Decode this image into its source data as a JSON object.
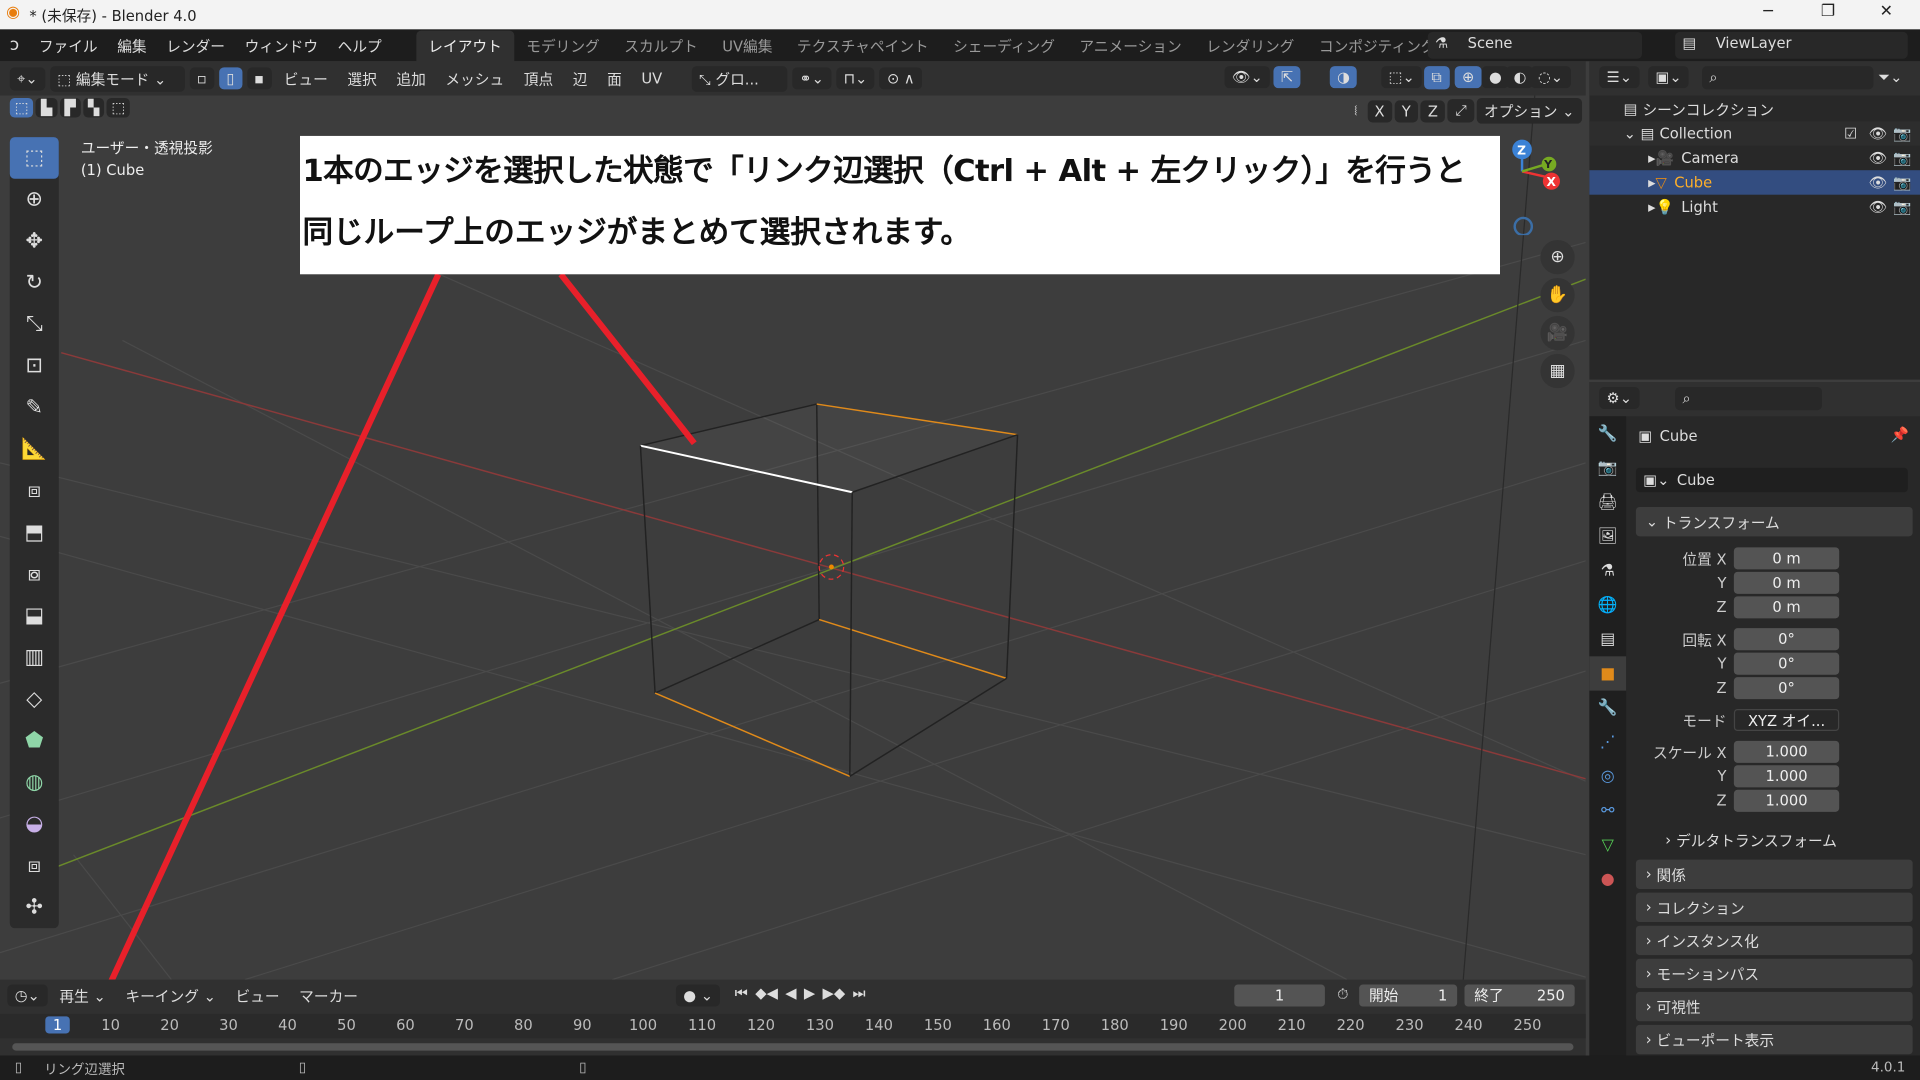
{
  "window": {
    "title": "* (未保存) - Blender 4.0",
    "min": "─",
    "max": "❐",
    "close": "✕"
  },
  "menu": {
    "items": [
      "ファイル",
      "編集",
      "レンダー",
      "ウィンドウ",
      "ヘルプ"
    ],
    "workspaces": [
      "レイアウト",
      "モデリング",
      "スカルプト",
      "UV編集",
      "テクスチャペイント",
      "シェーディング",
      "アニメーション",
      "レンダリング",
      "コンポジティング"
    ],
    "scene": "Scene",
    "view_layer": "ViewLayer"
  },
  "viewport_header": {
    "mode": "編集モード",
    "menus": [
      "ビュー",
      "選択",
      "追加",
      "メッシュ",
      "頂点",
      "辺",
      "面",
      "UV"
    ],
    "orientation": "グロ...",
    "options": "オプション",
    "axes": [
      "X",
      "Y",
      "Z"
    ]
  },
  "viewport": {
    "view_name": "ユーザー・透視投影",
    "object_name": "(1) Cube"
  },
  "annotation": {
    "line1": "1本のエッジを選択した状態で「リンク辺選択（Ctrl + Alt + 左クリック）」を行うと",
    "line2": "同じループ上のエッジがまとめて選択されます。",
    "color": "#e8202a"
  },
  "gizmo": {
    "z": "Z",
    "y": "Y",
    "x": "X"
  },
  "timeline": {
    "menus": [
      "再生",
      "キーイング",
      "ビュー",
      "マーカー"
    ],
    "current_frame": "1",
    "start_label": "開始",
    "start": "1",
    "end_label": "終了",
    "end": "250",
    "ticks": [
      "1",
      "10",
      "20",
      "30",
      "40",
      "50",
      "60",
      "70",
      "80",
      "90",
      "100",
      "110",
      "120",
      "130",
      "140",
      "150",
      "160",
      "170",
      "180",
      "190",
      "200",
      "210",
      "220",
      "230",
      "240",
      "250"
    ]
  },
  "status": {
    "hint": "リング辺選択",
    "version": "4.0.1"
  },
  "outliner": {
    "root": "シーンコレクション",
    "collection": "Collection",
    "items": [
      "Camera",
      "Cube",
      "Light"
    ]
  },
  "properties": {
    "object": "Cube",
    "datablock": "Cube",
    "transform": "トランスフォーム",
    "location_label": "位置 X",
    "rotation_label": "回転 X",
    "scale_label": "スケール X",
    "y": "Y",
    "z": "Z",
    "loc": [
      "0 m",
      "0 m",
      "0 m"
    ],
    "rot": [
      "0°",
      "0°",
      "0°"
    ],
    "mode_label": "モード",
    "mode": "XYZ オイ...",
    "scale": [
      "1.000",
      "1.000",
      "1.000"
    ],
    "panels": [
      "デルタトランスフォーム",
      "関係",
      "コレクション",
      "インスタンス化",
      "モーションパス",
      "可視性",
      "ビューポート表示"
    ]
  }
}
